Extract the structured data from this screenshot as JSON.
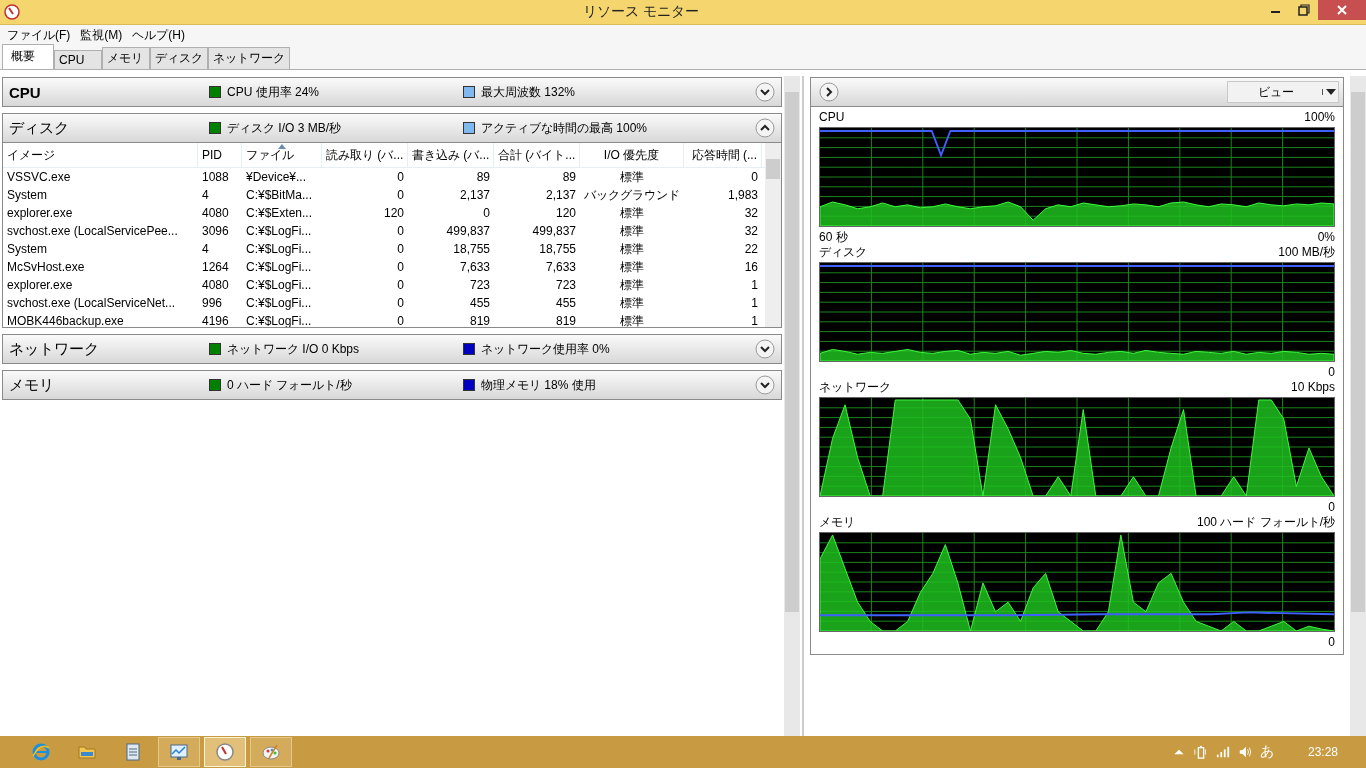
{
  "window": {
    "title": "リソース モニター"
  },
  "menu": [
    "ファイル(F)",
    "監視(M)",
    "ヘルプ(H)"
  ],
  "tabs": [
    {
      "label": "概要",
      "selected": true
    },
    {
      "label": "CPU",
      "selected": false
    },
    {
      "label": "メモリ",
      "selected": false
    },
    {
      "label": "ディスク",
      "selected": false
    },
    {
      "label": "ネットワーク",
      "selected": false
    }
  ],
  "sections": [
    {
      "title": "CPU",
      "expanded": false,
      "metrics": [
        {
          "label": "CPU 使用率 24%",
          "color": "#008000"
        },
        {
          "label": "最大周波数 132%",
          "color": "#80b8f0"
        }
      ]
    },
    {
      "title": "ディスク",
      "expanded": true,
      "metrics": [
        {
          "label": "ディスク I/O 3 MB/秒",
          "color": "#008000"
        },
        {
          "label": "アクティブな時間の最高 100%",
          "color": "#80b8f0"
        }
      ],
      "table": {
        "columns": [
          {
            "label": "イメージ",
            "sorted": false
          },
          {
            "label": "PID",
            "sorted": false
          },
          {
            "label": "ファイル",
            "sorted": true
          },
          {
            "label": "読み取り (バ...",
            "sorted": false
          },
          {
            "label": "書き込み (バ...",
            "sorted": false
          },
          {
            "label": "合計 (バイト...",
            "sorted": false
          },
          {
            "label": "I/O 優先度",
            "sorted": false
          },
          {
            "label": "応答時間 (...",
            "sorted": false
          }
        ],
        "rows": [
          [
            "VSSVC.exe",
            "1088",
            "¥Device¥...",
            "0",
            "89",
            "89",
            "標準",
            "0"
          ],
          [
            "System",
            "4",
            "C:¥$BitMa...",
            "0",
            "2,137",
            "2,137",
            "バックグラウンド",
            "1,983"
          ],
          [
            "explorer.exe",
            "4080",
            "C:¥$Exten...",
            "120",
            "0",
            "120",
            "標準",
            "32"
          ],
          [
            "svchost.exe (LocalServicePee...",
            "3096",
            "C:¥$LogFi...",
            "0",
            "499,837",
            "499,837",
            "標準",
            "32"
          ],
          [
            "System",
            "4",
            "C:¥$LogFi...",
            "0",
            "18,755",
            "18,755",
            "標準",
            "22"
          ],
          [
            "McSvHost.exe",
            "1264",
            "C:¥$LogFi...",
            "0",
            "7,633",
            "7,633",
            "標準",
            "16"
          ],
          [
            "explorer.exe",
            "4080",
            "C:¥$LogFi...",
            "0",
            "723",
            "723",
            "標準",
            "1"
          ],
          [
            "svchost.exe (LocalServiceNet...",
            "996",
            "C:¥$LogFi...",
            "0",
            "455",
            "455",
            "標準",
            "1"
          ],
          [
            "MOBK446backup.exe",
            "4196",
            "C:¥$LogFi...",
            "0",
            "819",
            "819",
            "標準",
            "1"
          ]
        ]
      }
    },
    {
      "title": "ネットワーク",
      "expanded": false,
      "metrics": [
        {
          "label": "ネットワーク I/O 0 Kbps",
          "color": "#008000"
        },
        {
          "label": "ネットワーク使用率 0%",
          "color": "#0000c0"
        }
      ]
    },
    {
      "title": "メモリ",
      "expanded": false,
      "metrics": [
        {
          "label": "0 ハード フォールト/秒",
          "color": "#008000"
        },
        {
          "label": "物理メモリ 18% 使用",
          "color": "#0000c0"
        }
      ]
    }
  ],
  "graph_panel": {
    "view_button": "ビュー",
    "graphs": [
      {
        "name": "CPU",
        "max": "100%",
        "time": "60 秒",
        "min": "0%"
      },
      {
        "name": "ディスク",
        "max": "100 MB/秒",
        "min": "0"
      },
      {
        "name": "ネットワーク",
        "max": "10 Kbps",
        "min": "0"
      },
      {
        "name": "メモリ",
        "max": "100 ハード フォールト/秒",
        "min": "0"
      }
    ]
  },
  "taskbar": {
    "apps": [
      {
        "kind": "browser",
        "running": false,
        "selected": false
      },
      {
        "kind": "folder",
        "running": false,
        "selected": false
      },
      {
        "kind": "notepad",
        "running": false,
        "selected": false
      },
      {
        "kind": "chart",
        "running": true,
        "selected": false
      },
      {
        "kind": "gauge",
        "running": true,
        "selected": true
      },
      {
        "kind": "paint",
        "running": true,
        "selected": false
      }
    ],
    "ime": "あ",
    "clock": "23:28"
  }
}
